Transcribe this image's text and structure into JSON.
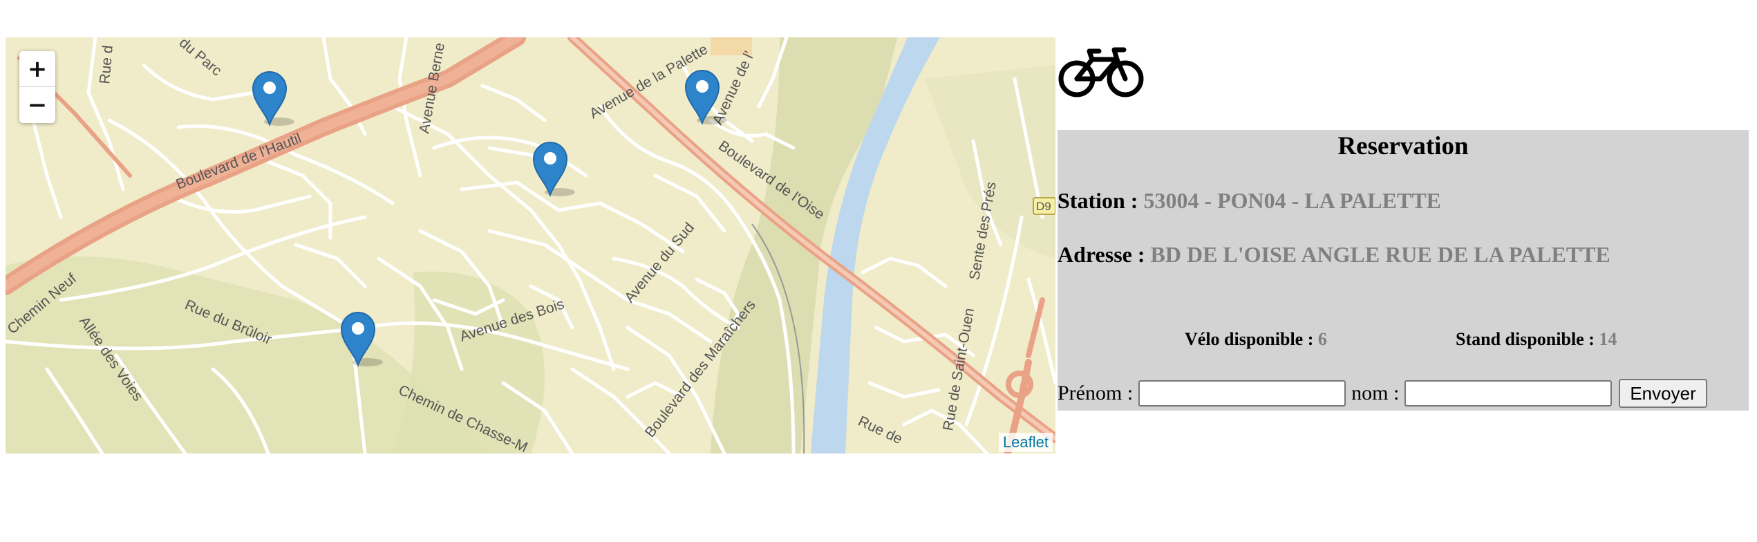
{
  "map": {
    "zoom_in": "+",
    "zoom_out": "−",
    "attribution": "Leaflet",
    "road_badge": "D9",
    "street_labels": [
      "Boulevard de l'Hautil",
      "Avenue Berne",
      "Avenue de la Palette",
      "Avenue de l'",
      "Boulevard de l'Oise",
      "Avenue du Sud",
      "Avenue des Bois",
      "Rue du Brûloir",
      "Chemin de Chasse-M",
      "Boulevard des Maraîchers",
      "Chemin Neuf",
      "Allée des Voies",
      "Rue de Saint-Ouen",
      "Sente des Prés",
      "Rue de",
      "Rue d",
      "du Parc"
    ],
    "markers": [
      {
        "label": "marker-1"
      },
      {
        "label": "marker-2"
      },
      {
        "label": "marker-3"
      },
      {
        "label": "marker-4"
      }
    ],
    "colors": {
      "land": "#f0ebc8",
      "river": "#bcd7ee",
      "highway": "#eaa287",
      "marker": "#2e84cb"
    }
  },
  "reservation": {
    "title": "Reservation",
    "station_label": "Station : ",
    "station_value": "53004 - PON04 - LA PALETTE",
    "address_label": "Adresse : ",
    "address_value": "BD DE L'OISE ANGLE RUE DE LA PALETTE",
    "bikes_label": "Vélo disponible : ",
    "bikes_value": "6",
    "stands_label": "Stand disponible : ",
    "stands_value": "14",
    "firstname_label": "Prénom :",
    "lastname_label": "nom :",
    "submit_label": "Envoyer"
  },
  "icons": {
    "bike": "bicycle-icon"
  }
}
